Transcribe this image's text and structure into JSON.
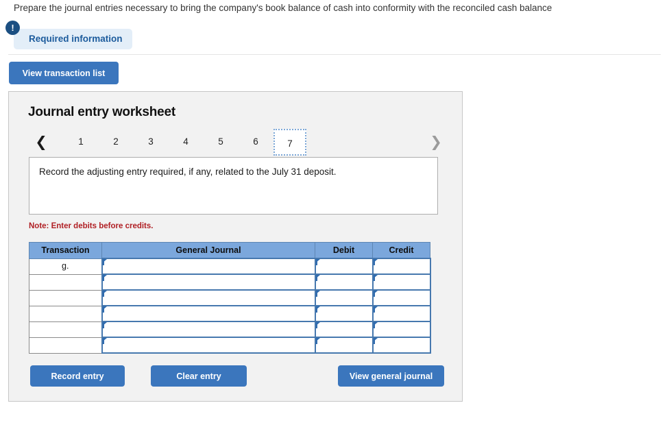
{
  "top_instruction": "Prepare the journal entries necessary to bring the company's book balance of cash into conformity with the reconciled cash balance",
  "required_banner": {
    "icon": "exclamation-icon",
    "icon_glyph": "!",
    "label": "Required information"
  },
  "toolbar": {
    "view_transaction_list_label": "View transaction list"
  },
  "worksheet": {
    "title": "Journal entry worksheet",
    "pagination": {
      "prev_icon": "chevron-left-icon",
      "next_icon": "chevron-right-icon",
      "prev_enabled": true,
      "next_enabled": false,
      "pages": [
        "1",
        "2",
        "3",
        "4",
        "5",
        "6",
        "7"
      ],
      "active_page": "7"
    },
    "instruction": "Record the adjusting entry required, if any, related to the July 31 deposit.",
    "note": "Note: Enter debits before credits.",
    "table": {
      "headers": [
        "Transaction",
        "General Journal",
        "Debit",
        "Credit"
      ],
      "rows": [
        {
          "transaction": "g.",
          "general_journal": "",
          "debit": "",
          "credit": ""
        },
        {
          "transaction": "",
          "general_journal": "",
          "debit": "",
          "credit": ""
        },
        {
          "transaction": "",
          "general_journal": "",
          "debit": "",
          "credit": ""
        },
        {
          "transaction": "",
          "general_journal": "",
          "debit": "",
          "credit": ""
        },
        {
          "transaction": "",
          "general_journal": "",
          "debit": "",
          "credit": ""
        },
        {
          "transaction": "",
          "general_journal": "",
          "debit": "",
          "credit": ""
        }
      ]
    },
    "footer": {
      "record_entry_label": "Record entry",
      "clear_entry_label": "Clear entry",
      "view_general_journal_label": "View general journal"
    }
  },
  "colors": {
    "accent_blue": "#3b76bd",
    "table_header_blue": "#7ba7dc",
    "input_border_blue": "#4678ae",
    "note_red": "#b01f24",
    "badge_bg": "#e3eef8",
    "badge_text": "#1c5b9c",
    "panel_bg": "#f2f2f2"
  }
}
